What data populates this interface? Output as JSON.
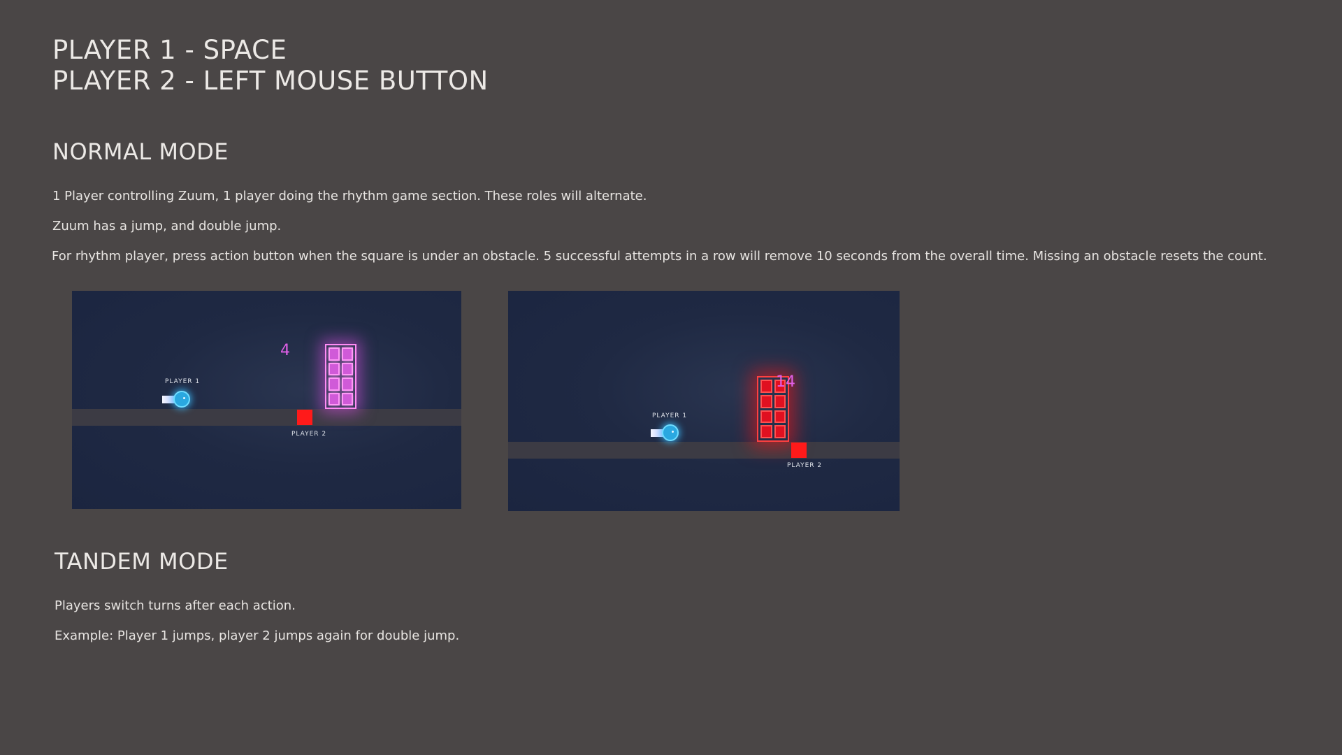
{
  "controls": {
    "player1": "PLAYER 1 - SPACE",
    "player2": "PLAYER 2 - LEFT MOUSE BUTTON"
  },
  "normal_mode": {
    "title": "NORMAL MODE",
    "paragraphs": [
      "1 Player controlling Zuum, 1 player doing the rhythm game section. These roles will alternate.",
      "Zuum has a jump, and double jump.",
      "For rhythm player, press action button when the square is under an obstacle. 5 successful attempts in a row will remove 10 seconds from the overall time. Missing an obstacle resets the count."
    ]
  },
  "screenshots": [
    {
      "counter": "4",
      "player1_label": "PLAYER 1",
      "player2_label": "PLAYER 2",
      "obstacle_color": "#d05ad8",
      "counter_color": "#e060e8",
      "player2_square_color": "#ff1a1a"
    },
    {
      "counter": "14",
      "player1_label": "PLAYER 1",
      "player2_label": "PLAYER 2",
      "obstacle_color": "#e01020",
      "counter_color": "#e060e8",
      "player2_square_color": "#ff1a1a"
    }
  ],
  "tandem_mode": {
    "title": "TANDEM MODE",
    "paragraphs": [
      "Players switch turns after each action.",
      "Example: Player 1 jumps, player 2 jumps again for double jump."
    ]
  },
  "colors": {
    "background": "#4a4646",
    "text": "#ece9e6",
    "player_ball": "#2aa8e0"
  }
}
